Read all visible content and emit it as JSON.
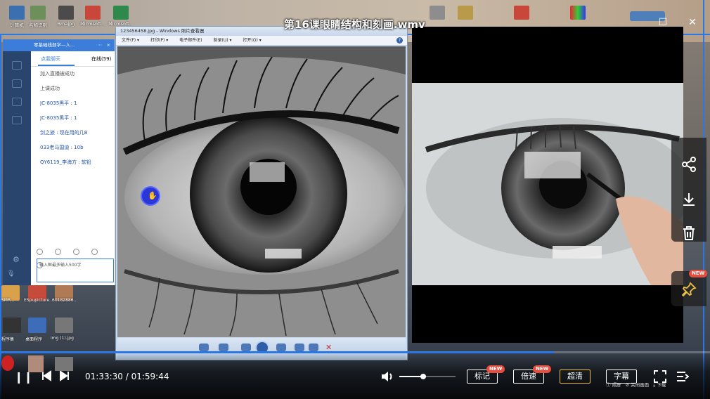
{
  "video": {
    "title": "第16课眼睛结构和刻画.wmv",
    "current_time": "01:33:30",
    "total_time": "01:59:44",
    "progress_fraction": 0.78,
    "volume_fraction": 0.43
  },
  "controls": {
    "mark_label": "标记",
    "speed_label": "倍速",
    "quality_label": "超清",
    "subtitle_label": "字幕",
    "new_badge": "NEW"
  },
  "desktop": {
    "icons": [
      "计算机",
      "名称识别",
      "Bmajpg",
      "Microsoft...",
      "Microsoft..."
    ],
    "bottom_icons": [
      "SMR...",
      "ESpupicture...",
      "60182886..."
    ],
    "bottom_row2": [
      "程序集",
      "桌面程序",
      "img (1).jpg"
    ]
  },
  "chat": {
    "header": "零基础线部学—人...",
    "tab_active": "点我聊天",
    "tab_other": "在线(59)",
    "messages": [
      {
        "text": "加入直播被成功",
        "style": "gray"
      },
      {
        "text": "上课成功",
        "style": "gray"
      },
      {
        "text": "JC-8035黑平 : 1",
        "style": "blue"
      },
      {
        "text": "JC-8035黑平 : 1",
        "style": "blue"
      },
      {
        "text": "剑之旅 : 现在用的几B",
        "style": "blue"
      },
      {
        "text": "033老马国迪 : 10b",
        "style": "blue"
      },
      {
        "text": "QY6119_李海方 : 软铅",
        "style": "blue"
      }
    ],
    "input_placeholder": "输入框最多输入500字"
  },
  "viewer": {
    "title": "123456458.jpg - Windows 照片查看器",
    "menu": [
      "文件(F) ▾",
      "打印(P) ▾",
      "电子邮件(E)",
      "刻录(U) ▾",
      "打开(O) ▾"
    ],
    "help": "?"
  },
  "status_strip": [
    "ⓘ 隔屏",
    "⊘ 关闭画面",
    "⤓ 下载"
  ],
  "colors": {
    "accent_blue": "#2b78e4",
    "badge_red": "#e84c3d",
    "quality_gold": "#f0c040"
  }
}
